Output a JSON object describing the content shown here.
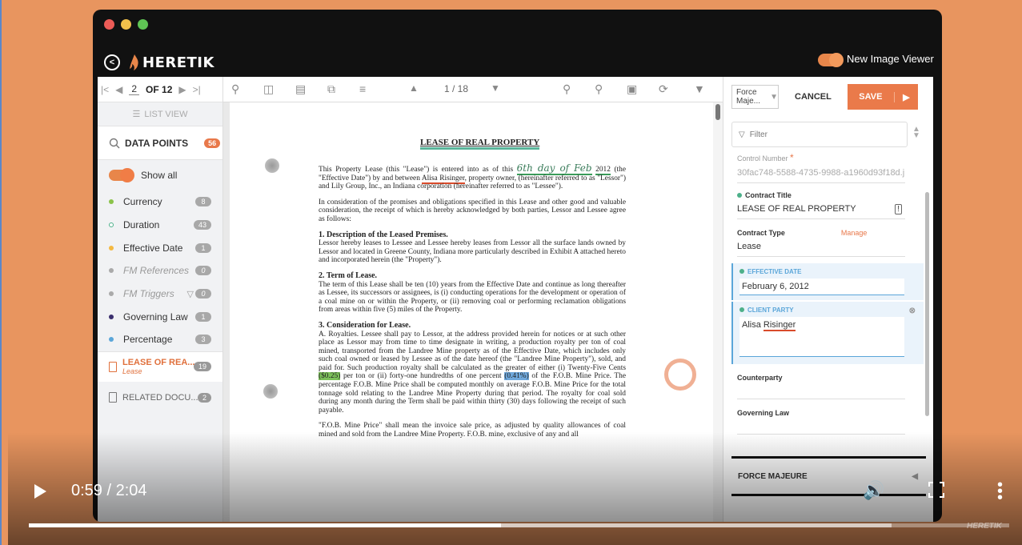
{
  "app": {
    "brand": "HERETIK",
    "new_image_viewer_label": "New Image Viewer"
  },
  "pager": {
    "current": "2",
    "of_label": "OF 12"
  },
  "left": {
    "list_view_label": "LIST VIEW",
    "data_points_label": "DATA POINTS",
    "data_points_count": "56",
    "show_all_label": "Show all",
    "categories": [
      {
        "label": "Currency",
        "count": "8",
        "color": "#8bc34a",
        "italic": false
      },
      {
        "label": "Duration",
        "count": "43",
        "color": "#4db08a",
        "italic": false
      },
      {
        "label": "Effective Date",
        "count": "1",
        "color": "#f4b942",
        "italic": false
      },
      {
        "label": "FM References",
        "count": "0",
        "color": "#aaaaaa",
        "italic": true
      },
      {
        "label": "FM Triggers",
        "count": "0",
        "color": "#aaaaaa",
        "italic": true
      },
      {
        "label": "Governing Law",
        "count": "1",
        "color": "#3b2f6e",
        "italic": false
      },
      {
        "label": "Percentage",
        "count": "3",
        "color": "#5ba6d9",
        "italic": false
      }
    ],
    "doc_item": {
      "title": "LEASE OF REA...",
      "subtitle": "Lease",
      "count": "19"
    },
    "related": {
      "title": "RELATED DOCU...",
      "count": "2"
    }
  },
  "doc": {
    "page_indicator": "1 / 18",
    "title": "LEASE OF REAL PROPERTY",
    "p1_a": "This Property Lease (this \"Lease\") is entered into as of this",
    "p1_sig": "6th day of Feb",
    "p1_year": "2012",
    "p1_b": "(the \"Effective Date\") by and between",
    "p1_name": "Alisa Risinger",
    "p1_c": ", property owner, (hereinafter referred to as \"Lessor\") and Lily Group, Inc., an Indiana corporation (hereinafter referred to as \"Lessee\").",
    "p2": "In consideration of the promises and obligations specified in this Lease and other good and valuable consideration, the receipt of which is hereby acknowledged by both parties, Lessor and Lessee agree as follows:",
    "s1_head": "1. Description of the Leased Premises.",
    "s1_body": "Lessor hereby leases to Lessee and Lessee hereby leases from Lessor all the surface lands owned by Lessor and located in Greene County, Indiana more particularly described in Exhibit A attached hereto and incorporated herein (the \"Property\").",
    "s2_head": "2. Term of Lease.",
    "s2_body": "The term of this Lease shall be ten (10) years from the Effective Date and continue as long thereafter as Lessee, its successors or assignees, is (i) conducting operations for the development or operation of a coal mine on or within the Property, or (ii) removing coal or performing reclamation obligations from areas within five (5) miles of the Property.",
    "s3_head": "3. Consideration for Lease.",
    "s3_a": "A. Royalties. Lessee shall pay to Lessor, at the address provided herein for notices or at such other place as Lessor may from time to time designate in writing, a production royalty per ton of coal mined, transported from the Landree Mine property as of the Effective Date, which includes only such coal owned or leased by Lessee as of the date hereof (the \"Landree Mine Property\"), sold, and paid for. Such production royalty shall be calculated as the greater of either (i) Twenty-Five Cents",
    "s3_amt": "($0.25)",
    "s3_b": "per ton or (ii) forty-one hundredths of one percent",
    "s3_pct": "(0.41%)",
    "s3_c": "of the F.O.B. Mine Price. The percentage F.O.B. Mine Price shall be computed monthly on average F.O.B. Mine Price for the total tonnage sold relating to the Landree Mine Property during that period. The royalty for coal sold during any month during the Term shall be paid within thirty (30) days following the receipt of such payable.",
    "s3_d": "\"F.O.B. Mine Price\" shall mean the invoice sale price, as adjusted by quality allowances of coal mined and sold from the Landree Mine Property. F.O.B. mine, exclusive of any and all"
  },
  "right": {
    "select_value": "Force Maje...",
    "cancel_label": "CANCEL",
    "save_label": "SAVE",
    "filter_placeholder": "Filter",
    "control_number_label": "Control Number",
    "control_number_value": "30fac748-5588-4735-9988-a1960d93f18d.j",
    "contract_title_label": "Contract Title",
    "contract_title_value": "LEASE OF REAL PROPERTY",
    "contract_type_label": "Contract Type",
    "manage_label": "Manage",
    "contract_type_value": "Lease",
    "effective_date_label": "EFFECTIVE DATE",
    "effective_date_value": "February 6, 2012",
    "client_party_label": "CLIENT PARTY",
    "client_party_value_a": "Alisa ",
    "client_party_value_b": "Risinger",
    "counterparty_label": "Counterparty",
    "governing_law_label": "Governing Law",
    "force_majeure_label": "FORCE MAJEURE"
  },
  "video": {
    "time": "0:59 / 2:04",
    "played_fraction": 0.482,
    "buffered_fraction": 0.88
  },
  "colors": {
    "accent": "#ea7a4a",
    "background": "#e8955f",
    "active_field": "#5ba6d9"
  }
}
